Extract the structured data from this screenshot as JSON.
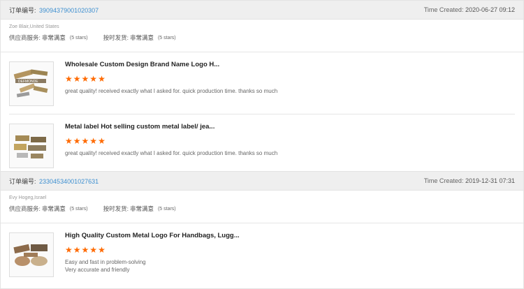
{
  "orders": [
    {
      "order_label": "订单编号:",
      "order_number": "39094379001020307",
      "time_label": "Time Created:",
      "time_value": "2020-06-27 09:12",
      "buyer": "Zoe Blair,United States",
      "ratings": [
        {
          "label": "供应商服务:",
          "value": "非常满意",
          "stars_text": "(5 stars)"
        },
        {
          "label": "按时发货:",
          "value": "非常满意",
          "stars_text": "(5 stars)"
        }
      ],
      "items": [
        {
          "title": "Wholesale Custom Design Brand Name Logo H...",
          "rating": 5,
          "comments": [
            "great quality! received exactly what I asked for. quick production time. thanks so much"
          ]
        },
        {
          "title": "Metal label Hot selling custom metal label/ jea...",
          "rating": 5,
          "comments": [
            "great quality! received exactly what I asked for. quick production time. thanks so much"
          ]
        }
      ]
    },
    {
      "order_label": "订单编号:",
      "order_number": "23304534001027631",
      "time_label": "Time Created:",
      "time_value": "2019-12-31 07:31",
      "buyer": "Evy Hogeg,Israel",
      "ratings": [
        {
          "label": "供应商服务:",
          "value": "非常满意",
          "stars_text": "(5 stars)"
        },
        {
          "label": "按时发货:",
          "value": "非常满意",
          "stars_text": "(5 stars)"
        }
      ],
      "items": [
        {
          "title": "High Quality Custom Metal Logo For Handbags, Lugg...",
          "rating": 5,
          "comments": [
            "Easy and fast in problem-solving",
            "Very accurate and friendly"
          ]
        }
      ]
    }
  ],
  "colors": {
    "accent_link": "#3d8fd0",
    "star": "#ff6a00",
    "header_bg": "#efefef"
  },
  "icons": {
    "star": "star-icon"
  }
}
